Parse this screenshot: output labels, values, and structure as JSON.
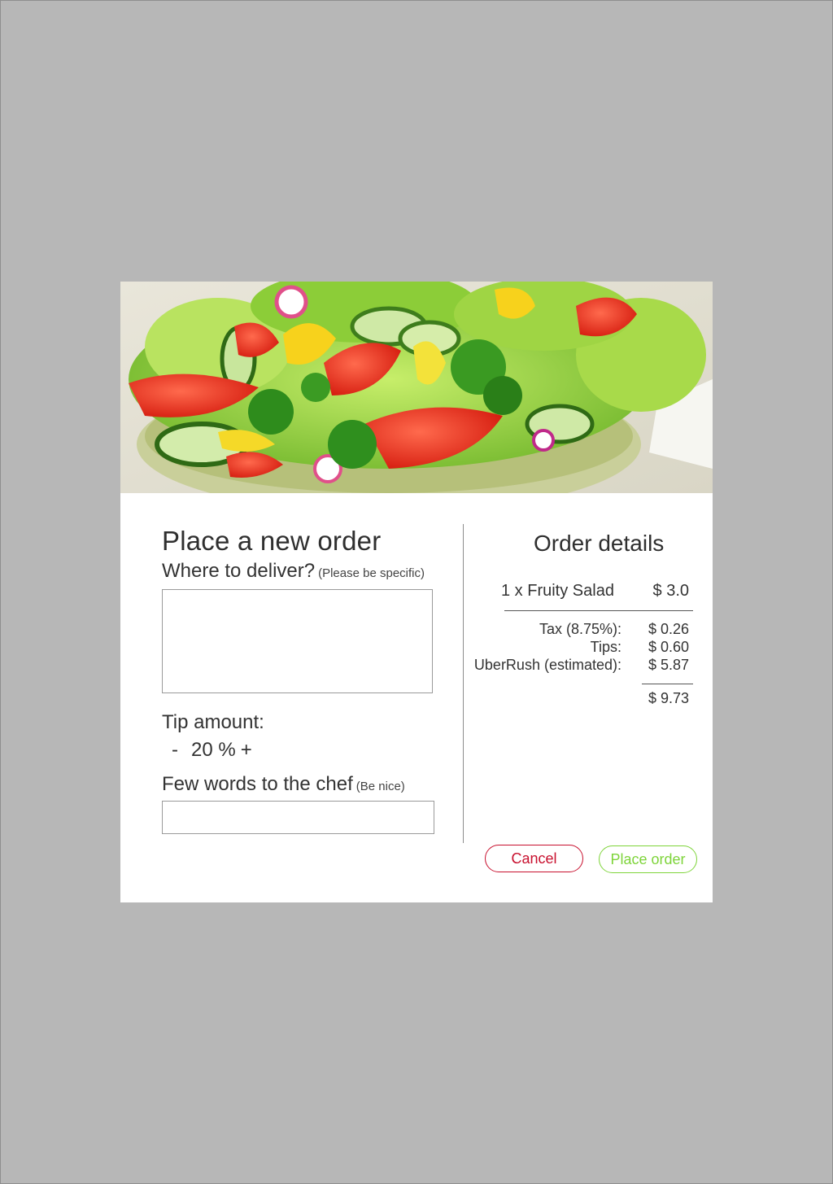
{
  "order_form": {
    "title": "Place a new order",
    "delivery_label": "Where to deliver?",
    "delivery_hint": "(Please be specific)",
    "delivery_value": "",
    "tip_label": "Tip amount:",
    "tip_decrement": "-",
    "tip_value": "20 %",
    "tip_increment": "+",
    "chef_label": "Few words to the chef",
    "chef_hint": "(Be nice)",
    "chef_value": ""
  },
  "order_details": {
    "title": "Order details",
    "item": {
      "name": "1 x Fruity Salad",
      "price": "$ 3.0"
    },
    "fees": [
      {
        "label": "Tax (8.75%):",
        "value": "$ 0.26"
      },
      {
        "label": "Tips:",
        "value": "$ 0.60"
      },
      {
        "label": "UberRush (estimated):",
        "value": "$ 5.87"
      }
    ],
    "total": "$ 9.73"
  },
  "actions": {
    "cancel_label": "Cancel",
    "place_label": "Place order"
  },
  "colors": {
    "cancel": "#c8102e",
    "place": "#7ed43a",
    "background": "#b7b7b7"
  }
}
